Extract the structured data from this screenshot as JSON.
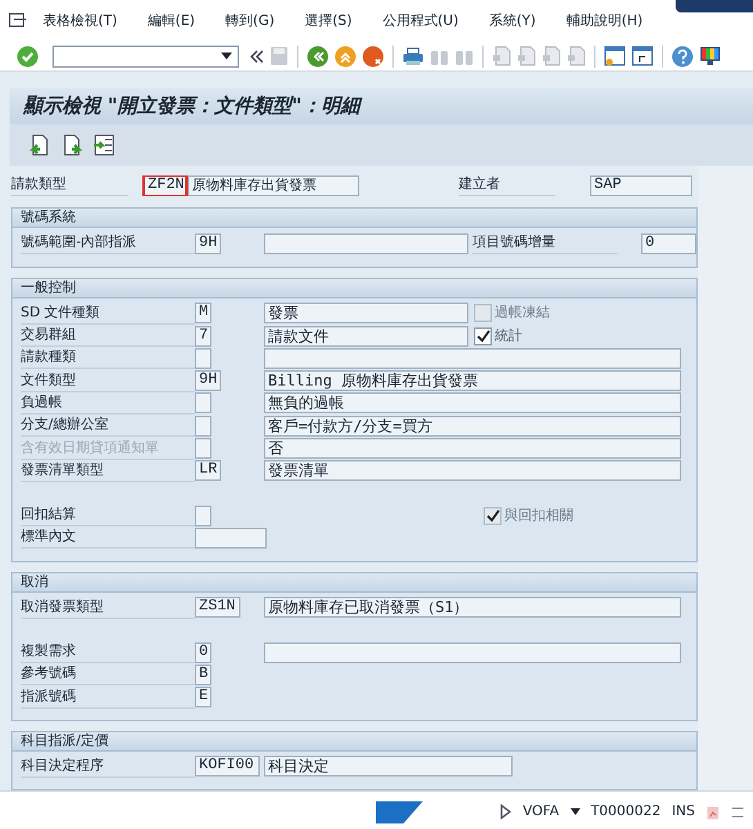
{
  "menu": [
    "表格檢視(T)",
    "編輯(E)",
    "轉到(G)",
    "選擇(S)",
    "公用程式(U)",
    "系統(Y)",
    "輔助說明(H)"
  ],
  "title": "顯示檢視 \"開立發票：文件類型\"：明細",
  "header": {
    "label": "請款類型",
    "code": "ZF2N",
    "focused": true,
    "desc": "原物料庫存出貨發票",
    "created_by_label": "建立者",
    "created_by": "SAP"
  },
  "groups": [
    {
      "title": "號碼系統",
      "rows": [
        {
          "kind": "entry",
          "label": "號碼範圍-內部指派",
          "code": "9H",
          "blank_desc": true,
          "extra": {
            "label": "項目號碼增量",
            "value": "0"
          }
        }
      ]
    },
    {
      "title": "一般控制",
      "rows": [
        {
          "kind": "entry",
          "label": "SD 文件種類",
          "code": "M",
          "desc": "發票",
          "check": {
            "label": "過帳凍結",
            "checked": false,
            "disabled": true
          }
        },
        {
          "kind": "entry",
          "label": "交易群組",
          "code": "7",
          "desc": "請款文件",
          "check": {
            "label": "統計",
            "checked": true,
            "disabled": false
          }
        },
        {
          "kind": "entry",
          "label": "請款種類",
          "blank_desc": true
        },
        {
          "kind": "entry",
          "label": "文件類型",
          "code": "9H",
          "desc": "Billing 原物料庫存出貨發票"
        },
        {
          "kind": "entry",
          "label": "負過帳",
          "desc": "無負的過帳"
        },
        {
          "kind": "entry",
          "label": "分支/總辦公室",
          "desc": "客戶=付款方/分支=買方"
        },
        {
          "kind": "entry",
          "label": "含有效日期貸項通知單",
          "disabled": true,
          "desc": "否"
        },
        {
          "kind": "entry",
          "label": "發票清單類型",
          "code": "LR",
          "desc": "發票清單"
        },
        {
          "kind": "gap"
        },
        {
          "kind": "entry",
          "label": "回扣結算",
          "check": {
            "label": "與回扣相關",
            "checked": true,
            "disabled": true
          }
        },
        {
          "kind": "text",
          "label": "標準內文"
        }
      ]
    },
    {
      "title": "取消",
      "rows": [
        {
          "kind": "entry",
          "label": "取消發票類型",
          "code": "ZS1N",
          "desc": "原物料庫存已取消發票（S1）"
        },
        {
          "kind": "gap"
        },
        {
          "kind": "entry",
          "label": "複製需求",
          "code": "0",
          "blank_desc": true
        },
        {
          "kind": "entry",
          "label": "參考號碼",
          "code": "B"
        },
        {
          "kind": "entry",
          "label": "指派號碼",
          "code": "E"
        }
      ]
    },
    {
      "title": "科目指派/定價",
      "rows": [
        {
          "kind": "entry",
          "label": "科目決定程序",
          "code": "KOFI00",
          "desc": "科目決定",
          "short_desc": true
        }
      ]
    }
  ],
  "status": {
    "transaction": "VOFA",
    "server": "T0000022",
    "mode": "INS"
  }
}
